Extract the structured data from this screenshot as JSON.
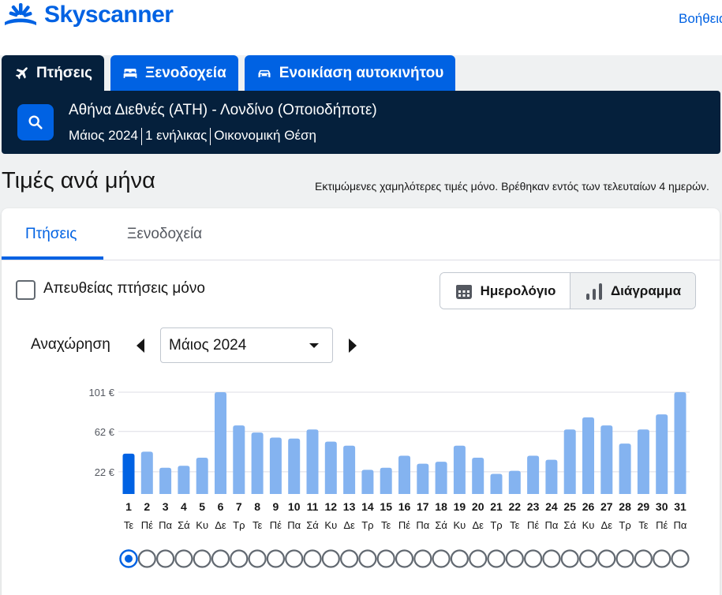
{
  "brand": {
    "name": "Skyscanner",
    "color": "#0062e3",
    "logo_icon": "sunburst-logo-icon"
  },
  "header": {
    "help_link": "Βοήθεια"
  },
  "tabs": [
    {
      "label": "Πτήσεις",
      "icon": "plane-icon",
      "active": true
    },
    {
      "label": "Ξενοδοχεία",
      "icon": "bed-icon",
      "active": false
    },
    {
      "label": "Ενοικίαση αυτοκινήτου",
      "icon": "car-icon",
      "active": false
    }
  ],
  "search": {
    "route": "Αθήνα Διεθνές (ATH) - Λονδίνο (Οποιοδήποτε)",
    "month": "Μάιος 2024",
    "travellers": "1 ενήλικας",
    "cabin": "Οικονομική Θέση",
    "icon": "search-icon"
  },
  "prices_section": {
    "title": "Τιμές ανά μήνα",
    "note": "Εκτιμώμενες χαμηλότερες τιμές μόνο. Βρέθηκαν εντός των τελευταίων 4 ημερών."
  },
  "card": {
    "tabs": [
      {
        "label": "Πτήσεις",
        "active": true
      },
      {
        "label": "Ξενοδοχεία",
        "active": false
      }
    ],
    "direct_only_label": "Απευθείας πτήσεις μόνο",
    "direct_only_checked": false,
    "view_calendar_label": "Ημερολόγιο",
    "view_chart_label": "Διάγραμμα",
    "active_view": "chart",
    "departure_label": "Αναχώρηση",
    "month_value": "Μάιος 2024"
  },
  "colors": {
    "navy": "#05203c",
    "bar": "#84b3f0",
    "bar_selected": "#0062e3",
    "grid": "#dddde5"
  },
  "chart_data": {
    "type": "bar",
    "title": "",
    "xlabel": "",
    "ylabel": "",
    "y_ticks": [
      {
        "value": 22,
        "label": "22 €"
      },
      {
        "value": 62,
        "label": "62 €"
      },
      {
        "value": 101,
        "label": "101 €"
      }
    ],
    "ylim": [
      0,
      101
    ],
    "categories": [
      "1",
      "2",
      "3",
      "4",
      "5",
      "6",
      "7",
      "8",
      "9",
      "10",
      "11",
      "12",
      "13",
      "14",
      "15",
      "16",
      "17",
      "18",
      "19",
      "20",
      "21",
      "22",
      "23",
      "24",
      "25",
      "26",
      "27",
      "28",
      "29",
      "30",
      "31"
    ],
    "weekdays": [
      "Τε",
      "Πέ",
      "Πα",
      "Σά",
      "Κυ",
      "Δε",
      "Τρ",
      "Τε",
      "Πέ",
      "Πα",
      "Σά",
      "Κυ",
      "Δε",
      "Τρ",
      "Τε",
      "Πέ",
      "Πα",
      "Σά",
      "Κυ",
      "Δε",
      "Τρ",
      "Τε",
      "Πέ",
      "Πα",
      "Σά",
      "Κυ",
      "Δε",
      "Τρ",
      "Τε",
      "Πέ",
      "Πα"
    ],
    "values": [
      40,
      42,
      26,
      28,
      36,
      101,
      68,
      61,
      56,
      55,
      64,
      52,
      48,
      24,
      26,
      38,
      30,
      32,
      48,
      36,
      20,
      23,
      38,
      34,
      64,
      76,
      68,
      50,
      64,
      79,
      101
    ],
    "selected_index": 0,
    "grid": true,
    "legend": "none"
  }
}
